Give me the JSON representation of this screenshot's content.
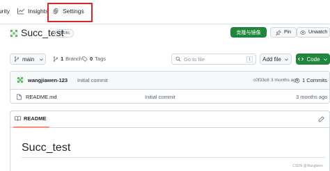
{
  "nav": {
    "security_label": "Security",
    "insights_label": "Insights",
    "settings_label": "Settings"
  },
  "repo": {
    "name": "Succ_test",
    "visibility": "Public",
    "clone_label": "克隆与镜像",
    "pin_label": "Pin",
    "unwatch_label": "Unwatch"
  },
  "toolbar": {
    "branch": "main",
    "branch_count": "1",
    "branch_word": "Branch",
    "tag_count": "0",
    "tag_word": "Tags",
    "search_placeholder": "Go to file",
    "search_shortcut": "t",
    "add_file_label": "Add file",
    "code_label": "Code"
  },
  "commit": {
    "author": "wangjiawen-123",
    "message": "Initial commit",
    "hash": "c0f33c8",
    "time": "3 months ago",
    "count_label": "1 Commits"
  },
  "files": [
    {
      "name": "README.md",
      "commit": "Initial commit",
      "time": "3 months ago"
    }
  ],
  "readme": {
    "tab_label": "README",
    "title": "Succ_test"
  },
  "watermark": "CSDN @Wanglwen",
  "colors": {
    "accent_green": "#1f883d",
    "highlight_red": "#d9252a",
    "tab_underline": "#fd8c73"
  }
}
